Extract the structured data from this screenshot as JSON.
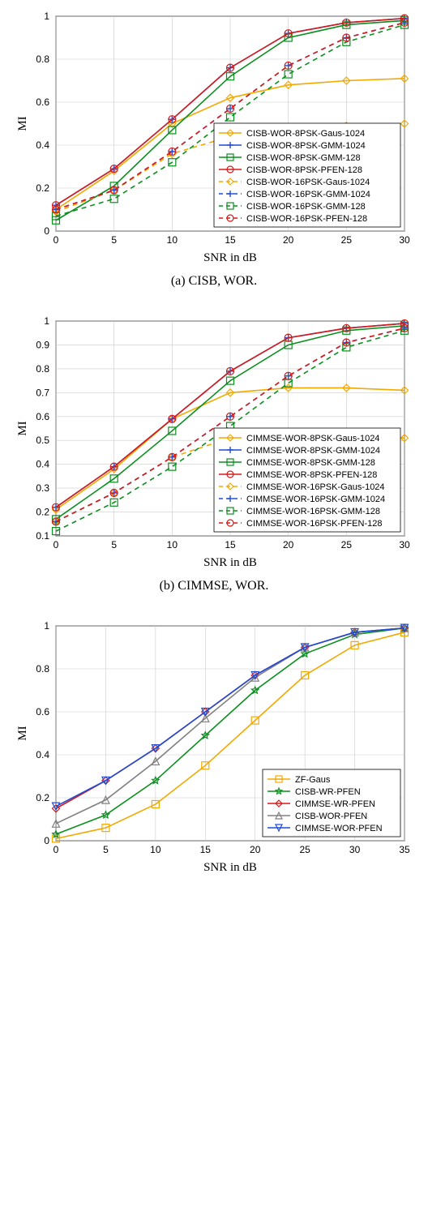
{
  "chart_data": [
    {
      "id": "a",
      "type": "line",
      "title": "",
      "caption": "(a)  CISB, WOR.",
      "xlabel": "SNR in dB",
      "ylabel": "MI",
      "xlim": [
        0,
        30
      ],
      "xticks": [
        0,
        5,
        10,
        15,
        20,
        25,
        30
      ],
      "ylim": [
        0,
        1
      ],
      "yticks": [
        0,
        0.2,
        0.4,
        0.6,
        0.8,
        1
      ],
      "legend_pos": "lower-right",
      "series": [
        {
          "name": "CISB-WOR-8PSK-Gaus-1024",
          "color": "#f2a900",
          "dash": "solid",
          "marker": "diamond",
          "x": [
            0,
            5,
            10,
            15,
            20,
            25,
            30
          ],
          "y": [
            0.1,
            0.28,
            0.5,
            0.62,
            0.68,
            0.7,
            0.71
          ]
        },
        {
          "name": "CISB-WOR-8PSK-GMM-1024",
          "color": "#1f4bd6",
          "dash": "solid",
          "marker": "plus",
          "x": [
            0,
            5,
            10,
            15,
            20,
            25,
            30
          ],
          "y": [
            0.12,
            0.29,
            0.52,
            0.76,
            0.92,
            0.97,
            0.99
          ]
        },
        {
          "name": "CISB-WOR-8PSK-GMM-128",
          "color": "#0a8f1e",
          "dash": "solid",
          "marker": "square",
          "x": [
            0,
            5,
            10,
            15,
            20,
            25,
            30
          ],
          "y": [
            0.05,
            0.21,
            0.47,
            0.72,
            0.9,
            0.96,
            0.98
          ]
        },
        {
          "name": "CISB-WOR-8PSK-PFEN-128",
          "color": "#d61a1a",
          "dash": "solid",
          "marker": "circle",
          "x": [
            0,
            5,
            10,
            15,
            20,
            25,
            30
          ],
          "y": [
            0.12,
            0.29,
            0.52,
            0.76,
            0.92,
            0.97,
            0.99
          ]
        },
        {
          "name": "CISB-WOR-16PSK-Gaus-1024",
          "color": "#f2a900",
          "dash": "dash",
          "marker": "diamond",
          "x": [
            0,
            5,
            10,
            15,
            20,
            25,
            30
          ],
          "y": [
            0.09,
            0.19,
            0.36,
            0.44,
            0.48,
            0.49,
            0.5
          ]
        },
        {
          "name": "CISB-WOR-16PSK-GMM-1024",
          "color": "#1f4bd6",
          "dash": "dash",
          "marker": "plus",
          "x": [
            0,
            5,
            10,
            15,
            20,
            25,
            30
          ],
          "y": [
            0.1,
            0.19,
            0.37,
            0.57,
            0.77,
            0.9,
            0.97
          ]
        },
        {
          "name": "CISB-WOR-16PSK-GMM-128",
          "color": "#0a8f1e",
          "dash": "dash",
          "marker": "square",
          "x": [
            0,
            5,
            10,
            15,
            20,
            25,
            30
          ],
          "y": [
            0.07,
            0.15,
            0.32,
            0.53,
            0.73,
            0.88,
            0.96
          ]
        },
        {
          "name": "CISB-WOR-16PSK-PFEN-128",
          "color": "#d61a1a",
          "dash": "dash",
          "marker": "circle",
          "x": [
            0,
            5,
            10,
            15,
            20,
            25,
            30
          ],
          "y": [
            0.1,
            0.19,
            0.37,
            0.57,
            0.77,
            0.9,
            0.97
          ]
        }
      ]
    },
    {
      "id": "b",
      "type": "line",
      "title": "",
      "caption": "(b)  CIMMSE, WOR.",
      "xlabel": "SNR in dB",
      "ylabel": "MI",
      "xlim": [
        0,
        30
      ],
      "xticks": [
        0,
        5,
        10,
        15,
        20,
        25,
        30
      ],
      "ylim": [
        0.1,
        1
      ],
      "yticks": [
        0.1,
        0.2,
        0.3,
        0.4,
        0.5,
        0.6,
        0.7,
        0.8,
        0.9,
        1
      ],
      "legend_pos": "lower-right",
      "series": [
        {
          "name": "CIMMSE-WOR-8PSK-Gaus-1024",
          "color": "#f2a900",
          "dash": "solid",
          "marker": "diamond",
          "x": [
            0,
            5,
            10,
            15,
            20,
            25,
            30
          ],
          "y": [
            0.21,
            0.38,
            0.59,
            0.7,
            0.72,
            0.72,
            0.71
          ]
        },
        {
          "name": "CIMMSE-WOR-8PSK-GMM-1024",
          "color": "#1f4bd6",
          "dash": "solid",
          "marker": "plus",
          "x": [
            0,
            5,
            10,
            15,
            20,
            25,
            30
          ],
          "y": [
            0.22,
            0.39,
            0.59,
            0.79,
            0.93,
            0.97,
            0.99
          ]
        },
        {
          "name": "CIMMSE-WOR-8PSK-GMM-128",
          "color": "#0a8f1e",
          "dash": "solid",
          "marker": "square",
          "x": [
            0,
            5,
            10,
            15,
            20,
            25,
            30
          ],
          "y": [
            0.17,
            0.34,
            0.54,
            0.75,
            0.9,
            0.96,
            0.98
          ]
        },
        {
          "name": "CIMMSE-WOR-8PSK-PFEN-128",
          "color": "#d61a1a",
          "dash": "solid",
          "marker": "circle",
          "x": [
            0,
            5,
            10,
            15,
            20,
            25,
            30
          ],
          "y": [
            0.22,
            0.39,
            0.59,
            0.79,
            0.93,
            0.97,
            0.99
          ]
        },
        {
          "name": "CIMMSE-WOR-16PSK-Gaus-1024",
          "color": "#f2a900",
          "dash": "dash",
          "marker": "diamond",
          "x": [
            0,
            5,
            10,
            15,
            20,
            25,
            30
          ],
          "y": [
            0.16,
            0.28,
            0.43,
            0.51,
            0.53,
            0.52,
            0.51
          ]
        },
        {
          "name": "CIMMSE-WOR-16PSK-GMM-1024",
          "color": "#1f4bd6",
          "dash": "dash",
          "marker": "plus",
          "x": [
            0,
            5,
            10,
            15,
            20,
            25,
            30
          ],
          "y": [
            0.16,
            0.28,
            0.43,
            0.6,
            0.77,
            0.91,
            0.97
          ]
        },
        {
          "name": "CIMMSE-WOR-16PSK-GMM-128",
          "color": "#0a8f1e",
          "dash": "dash",
          "marker": "square",
          "x": [
            0,
            5,
            10,
            15,
            20,
            25,
            30
          ],
          "y": [
            0.12,
            0.24,
            0.39,
            0.56,
            0.74,
            0.89,
            0.96
          ]
        },
        {
          "name": "CIMMSE-WOR-16PSK-PFEN-128",
          "color": "#d61a1a",
          "dash": "dash",
          "marker": "circle",
          "x": [
            0,
            5,
            10,
            15,
            20,
            25,
            30
          ],
          "y": [
            0.16,
            0.28,
            0.43,
            0.6,
            0.77,
            0.91,
            0.97
          ]
        }
      ]
    },
    {
      "id": "c",
      "type": "line",
      "title": "",
      "caption": "",
      "xlabel": "SNR in dB",
      "ylabel": "MI",
      "xlim": [
        0,
        35
      ],
      "xticks": [
        0,
        5,
        10,
        15,
        20,
        25,
        30,
        35
      ],
      "ylim": [
        0,
        1
      ],
      "yticks": [
        0,
        0.2,
        0.4,
        0.6,
        0.8,
        1
      ],
      "legend_pos": "lower-right",
      "series": [
        {
          "name": "ZF-Gaus",
          "color": "#f2a900",
          "dash": "solid",
          "marker": "square",
          "x": [
            0,
            5,
            10,
            15,
            20,
            25,
            30,
            35
          ],
          "y": [
            0.01,
            0.06,
            0.17,
            0.35,
            0.56,
            0.77,
            0.91,
            0.97
          ]
        },
        {
          "name": "CISB-WR-PFEN",
          "color": "#0a8f1e",
          "dash": "solid",
          "marker": "pentagram",
          "x": [
            0,
            5,
            10,
            15,
            20,
            25,
            30,
            35
          ],
          "y": [
            0.03,
            0.12,
            0.28,
            0.49,
            0.7,
            0.87,
            0.96,
            0.99
          ]
        },
        {
          "name": "CIMMSE-WR-PFEN",
          "color": "#d61a1a",
          "dash": "solid",
          "marker": "diamond",
          "x": [
            0,
            5,
            10,
            15,
            20,
            25,
            30,
            35
          ],
          "y": [
            0.15,
            0.28,
            0.43,
            0.6,
            0.77,
            0.9,
            0.97,
            0.99
          ]
        },
        {
          "name": "CISB-WOR-PFEN",
          "color": "#808080",
          "dash": "solid",
          "marker": "triangle-up",
          "x": [
            0,
            5,
            10,
            15,
            20,
            25,
            30,
            35
          ],
          "y": [
            0.08,
            0.19,
            0.37,
            0.57,
            0.76,
            0.9,
            0.97,
            0.99
          ]
        },
        {
          "name": "CIMMSE-WOR-PFEN",
          "color": "#1f4bd6",
          "dash": "solid",
          "marker": "triangle-down",
          "x": [
            0,
            5,
            10,
            15,
            20,
            25,
            30,
            35
          ],
          "y": [
            0.16,
            0.28,
            0.43,
            0.6,
            0.77,
            0.9,
            0.97,
            0.99
          ]
        }
      ]
    }
  ]
}
